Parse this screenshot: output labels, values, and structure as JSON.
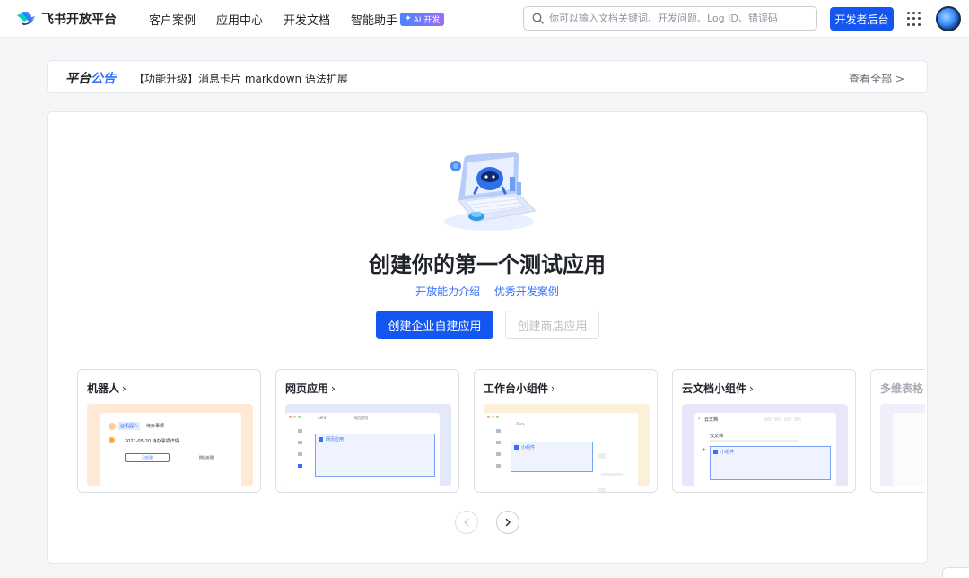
{
  "header": {
    "brand_name": "飞书开放平台",
    "nav": [
      {
        "label": "客户案例"
      },
      {
        "label": "应用中心"
      },
      {
        "label": "开发文档"
      },
      {
        "label": "智能助手",
        "badge": "AI 开发"
      }
    ],
    "search_placeholder": "你可以输入文档关键词、开发问题、Log ID、错误码",
    "console_button": "开发者后台"
  },
  "notice": {
    "title_prefix": "平台",
    "title_suffix": "公告",
    "text": "【功能升级】消息卡片 markdown 语法扩展",
    "view_all": "查看全部 >"
  },
  "hero": {
    "title": "创建你的第一个测试应用",
    "links": [
      "开放能力介绍",
      "优秀开发案例"
    ],
    "primary_button": "创建企业自建应用",
    "secondary_button": "创建商店应用"
  },
  "templates": [
    {
      "title": "机器人",
      "preview": {
        "tag": "@机器人",
        "tag_text": "待办事项",
        "line": "2022-05-20 待办事项详情",
        "btn_a": "已处理",
        "btn_b": "稍后处理"
      }
    },
    {
      "title": "网页应用",
      "preview": {
        "tab1": "Zera",
        "tab2": "网页应用",
        "panel": "网页应用"
      }
    },
    {
      "title": "工作台小组件",
      "preview": {
        "tab1": "Zera",
        "panel": "小组件"
      }
    },
    {
      "title": "云文档小组件",
      "preview": {
        "heading": "云文档",
        "sub": "云文档",
        "panel": "小组件"
      }
    },
    {
      "title": "多维表格"
    }
  ],
  "colors": {
    "primary": "#1456f0",
    "link": "#3370ff",
    "bot_preview_bg": "#fde9d6",
    "web_preview_bg": "#e3e9fb",
    "widget_preview_bg": "#fdf0d9",
    "doc_preview_bg": "#e8e6f9"
  }
}
